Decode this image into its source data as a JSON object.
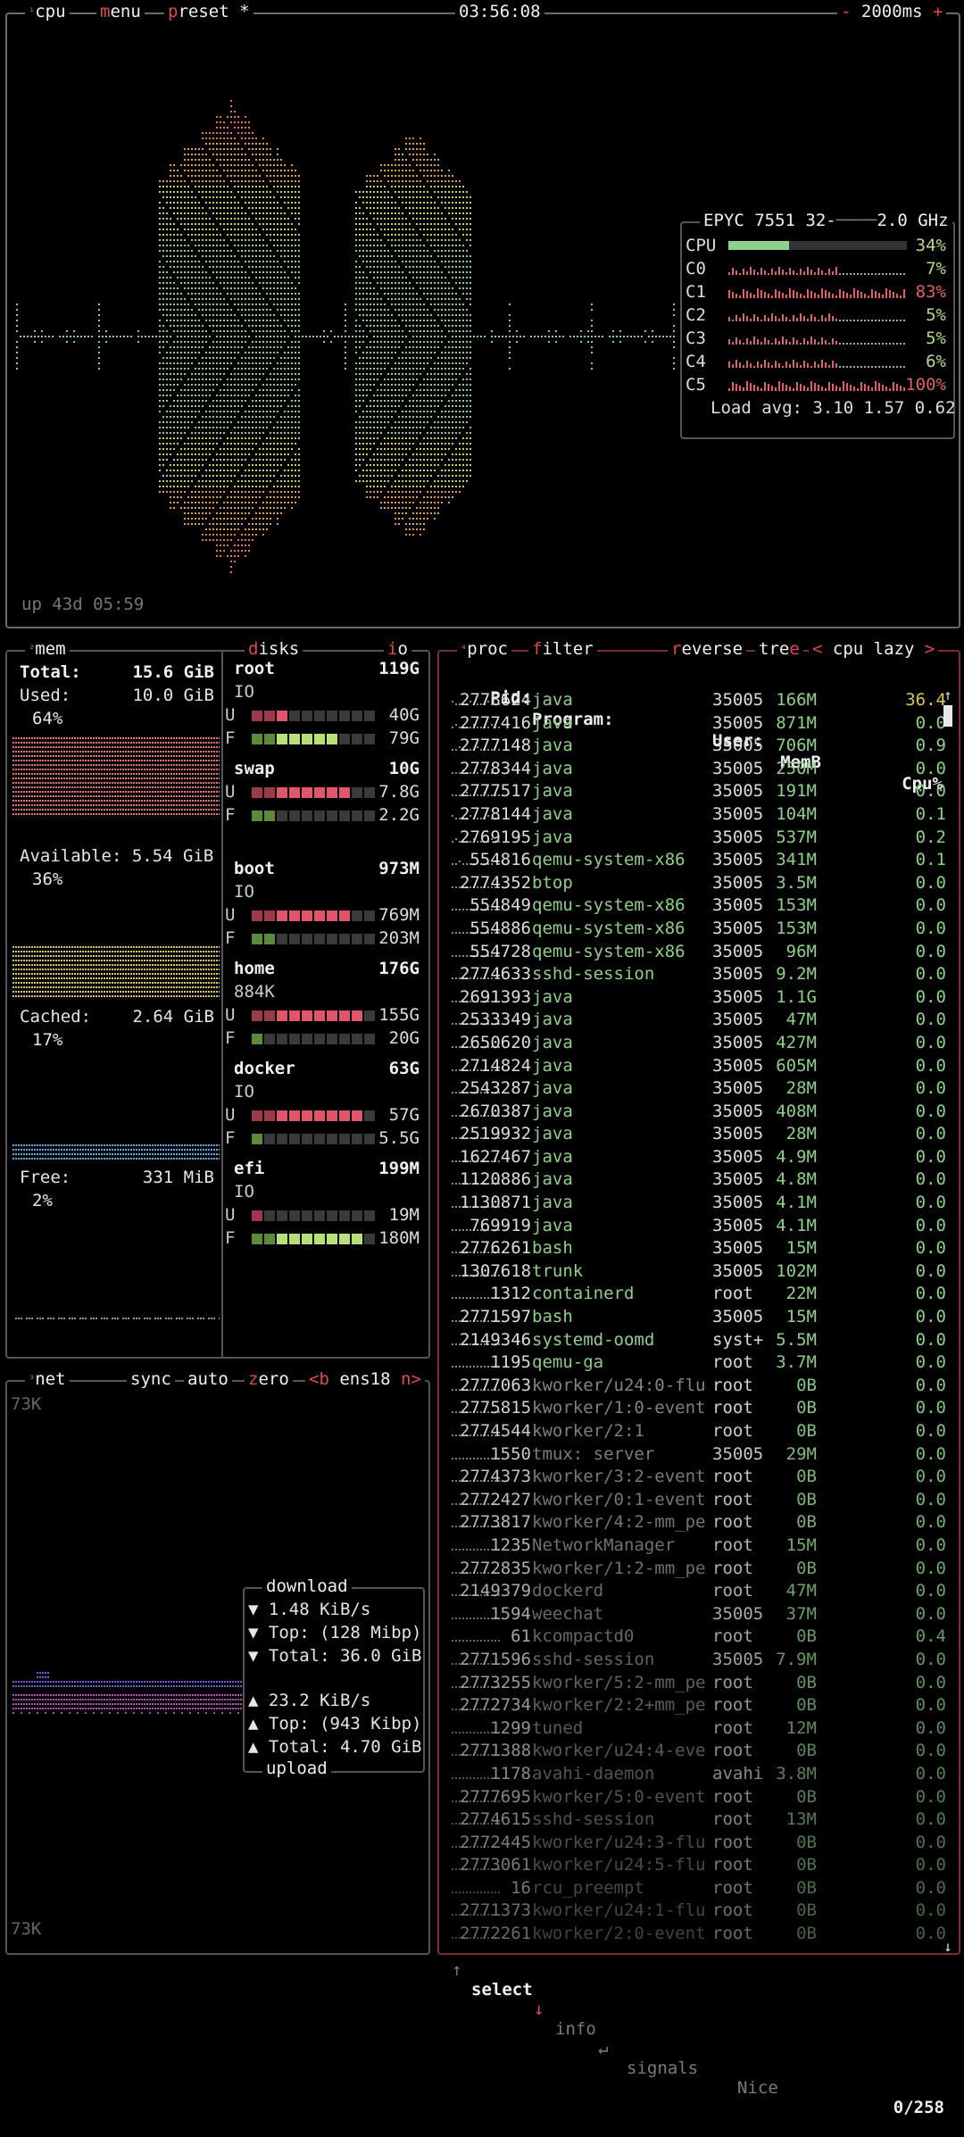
{
  "cpu": {
    "tab": "cpu",
    "tab_num": "¹",
    "menu": "menu",
    "preset": "preset *",
    "clock": "03:56:08",
    "minus": "-",
    "interval": "2000ms",
    "plus": "+",
    "uptime": "up 43d 05:59",
    "model": "EPYC 7551 32-",
    "freq": "2.0 GHz",
    "rows": [
      {
        "label": "CPU",
        "pct": "34%",
        "value": 34,
        "color": "#b7d982"
      },
      {
        "label": "C0",
        "pct": "7%",
        "value": 7,
        "color": "#b7d982"
      },
      {
        "label": "C1",
        "pct": "83%",
        "value": 83,
        "color": "#e06060"
      },
      {
        "label": "C2",
        "pct": "5%",
        "value": 5,
        "color": "#b7d982"
      },
      {
        "label": "C3",
        "pct": "5%",
        "value": 5,
        "color": "#b7d982"
      },
      {
        "label": "C4",
        "pct": "6%",
        "value": 6,
        "color": "#b7d982"
      },
      {
        "label": "C5",
        "pct": "100%",
        "value": 100,
        "color": "#e06060"
      }
    ],
    "load_label": "Load avg:",
    "load": "3.10 1.57 0.62"
  },
  "mem": {
    "tab_num": "²",
    "tab": "mem",
    "total_label": "Total:",
    "total": "15.6 GiB",
    "used_label": "Used:",
    "used": "10.0 GiB",
    "used_pct": "64%",
    "avail_label": "Available:",
    "avail": "5.54 GiB",
    "avail_pct": "36%",
    "cached_label": "Cached:",
    "cached": "2.64 GiB",
    "cached_pct": "17%",
    "free_label": "Free:",
    "free": "331 MiB",
    "free_pct": "2%",
    "colors": {
      "used": "#e07070",
      "avail": "#d9c65a",
      "cached": "#5aa9d9",
      "free": "#9c9c9c"
    }
  },
  "disks": {
    "tab": "disks",
    "io_tab": "io",
    "items": [
      {
        "name": "root",
        "size": "119G",
        "io": "IO",
        "u": "40G",
        "u_frac": 0.33,
        "f": "79G",
        "f_frac": 0.66
      },
      {
        "name": "swap",
        "size": "10G",
        "io": "",
        "u": "7.8G",
        "u_frac": 0.78,
        "f": "2.2G",
        "f_frac": 0.22
      },
      {
        "name": "boot",
        "size": "973M",
        "io": "IO",
        "u": "769M",
        "u_frac": 0.79,
        "f": "203M",
        "f_frac": 0.21
      },
      {
        "name": "home",
        "size": "176G",
        "io": "884K",
        "u": "155G",
        "u_frac": 0.88,
        "f": "20G",
        "f_frac": 0.12
      },
      {
        "name": "docker",
        "size": "63G",
        "io": "IO",
        "u": "57G",
        "u_frac": 0.9,
        "f": "5.5G",
        "f_frac": 0.1
      },
      {
        "name": "efi",
        "size": "199M",
        "io": "IO",
        "u": "19M",
        "u_frac": 0.1,
        "f": "180M",
        "f_frac": 0.9
      }
    ]
  },
  "net": {
    "tab_num": "³",
    "tab": "net",
    "sync": "sync",
    "auto": "auto",
    "zero": "zero",
    "prev": "<b",
    "iface": "ens18",
    "next": "n>",
    "scale_top": "73K",
    "scale_bottom": "73K",
    "download_title": "download",
    "dl_rate": "▼ 1.48 KiB/s",
    "dl_top": "▼ Top: (128 Mibp)",
    "dl_total": "▼ Total: 36.0 GiB",
    "ul_rate": "▲ 23.2 KiB/s",
    "ul_top": "▲ Top: (943 Kibp)",
    "ul_total": "▲ Total: 4.70 GiB",
    "upload_title": "upload"
  },
  "proc": {
    "tab_num": "⁴",
    "tab": "proc",
    "filter": "filter",
    "reverse": "reverse",
    "tree": "tree",
    "sort_prev": "<",
    "sort": "cpu lazy",
    "sort_next": ">",
    "headers": {
      "pid": "Pid:",
      "program": "Program:",
      "user": "User:",
      "mem": "MemB",
      "cpu": "Cpu%"
    },
    "rows": [
      {
        "pid": "2778624",
        "prog": "java",
        "user": "35005",
        "mem": "166M",
        "cpu": "36.4"
      },
      {
        "pid": "2777416",
        "prog": "java",
        "user": "35005",
        "mem": "871M",
        "cpu": "0.0"
      },
      {
        "pid": "2777148",
        "prog": "java",
        "user": "35005",
        "mem": "706M",
        "cpu": "0.9"
      },
      {
        "pid": "2778344",
        "prog": "java",
        "user": "35005",
        "mem": "250M",
        "cpu": "0.0"
      },
      {
        "pid": "2777517",
        "prog": "java",
        "user": "35005",
        "mem": "191M",
        "cpu": "0.0"
      },
      {
        "pid": "2778144",
        "prog": "java",
        "user": "35005",
        "mem": "104M",
        "cpu": "0.1"
      },
      {
        "pid": "2769195",
        "prog": "java",
        "user": "35005",
        "mem": "537M",
        "cpu": "0.2"
      },
      {
        "pid": "554816",
        "prog": "qemu-system-x86",
        "user": "35005",
        "mem": "341M",
        "cpu": "0.1"
      },
      {
        "pid": "2774352",
        "prog": "btop",
        "user": "35005",
        "mem": "3.5M",
        "cpu": "0.0"
      },
      {
        "pid": "554849",
        "prog": "qemu-system-x86",
        "user": "35005",
        "mem": "153M",
        "cpu": "0.0"
      },
      {
        "pid": "554886",
        "prog": "qemu-system-x86",
        "user": "35005",
        "mem": "153M",
        "cpu": "0.0"
      },
      {
        "pid": "554728",
        "prog": "qemu-system-x86",
        "user": "35005",
        "mem": "96M",
        "cpu": "0.0"
      },
      {
        "pid": "2774633",
        "prog": "sshd-session",
        "user": "35005",
        "mem": "9.2M",
        "cpu": "0.0"
      },
      {
        "pid": "2691393",
        "prog": "java",
        "user": "35005",
        "mem": "1.1G",
        "cpu": "0.0"
      },
      {
        "pid": "2533349",
        "prog": "java",
        "user": "35005",
        "mem": "47M",
        "cpu": "0.0"
      },
      {
        "pid": "2650620",
        "prog": "java",
        "user": "35005",
        "mem": "427M",
        "cpu": "0.0"
      },
      {
        "pid": "2714824",
        "prog": "java",
        "user": "35005",
        "mem": "605M",
        "cpu": "0.0"
      },
      {
        "pid": "2543287",
        "prog": "java",
        "user": "35005",
        "mem": "28M",
        "cpu": "0.0"
      },
      {
        "pid": "2670387",
        "prog": "java",
        "user": "35005",
        "mem": "408M",
        "cpu": "0.0"
      },
      {
        "pid": "2519932",
        "prog": "java",
        "user": "35005",
        "mem": "28M",
        "cpu": "0.0"
      },
      {
        "pid": "1627467",
        "prog": "java",
        "user": "35005",
        "mem": "4.9M",
        "cpu": "0.0"
      },
      {
        "pid": "1120886",
        "prog": "java",
        "user": "35005",
        "mem": "4.8M",
        "cpu": "0.0"
      },
      {
        "pid": "1130871",
        "prog": "java",
        "user": "35005",
        "mem": "4.1M",
        "cpu": "0.0"
      },
      {
        "pid": "769919",
        "prog": "java",
        "user": "35005",
        "mem": "4.1M",
        "cpu": "0.0"
      },
      {
        "pid": "2776261",
        "prog": "bash",
        "user": "35005",
        "mem": "15M",
        "cpu": "0.0"
      },
      {
        "pid": "1307618",
        "prog": "trunk",
        "user": "35005",
        "mem": "102M",
        "cpu": "0.0"
      },
      {
        "pid": "1312",
        "prog": "containerd",
        "user": "root",
        "mem": "22M",
        "cpu": "0.0"
      },
      {
        "pid": "2771597",
        "prog": "bash",
        "user": "35005",
        "mem": "15M",
        "cpu": "0.0"
      },
      {
        "pid": "2149346",
        "prog": "systemd-oomd",
        "user": "syst+",
        "mem": "5.5M",
        "cpu": "0.0"
      },
      {
        "pid": "1195",
        "prog": "qemu-ga",
        "user": "root",
        "mem": "3.7M",
        "cpu": "0.0"
      },
      {
        "pid": "2777063",
        "prog": "kworker/u24:0-flu",
        "user": "root",
        "mem": "0B",
        "cpu": "0.0"
      },
      {
        "pid": "2775815",
        "prog": "kworker/1:0-event",
        "user": "root",
        "mem": "0B",
        "cpu": "0.0"
      },
      {
        "pid": "2774544",
        "prog": "kworker/2:1",
        "user": "root",
        "mem": "0B",
        "cpu": "0.0"
      },
      {
        "pid": "1550",
        "prog": "tmux: server",
        "user": "35005",
        "mem": "29M",
        "cpu": "0.0"
      },
      {
        "pid": "2774373",
        "prog": "kworker/3:2-event",
        "user": "root",
        "mem": "0B",
        "cpu": "0.0"
      },
      {
        "pid": "2772427",
        "prog": "kworker/0:1-event",
        "user": "root",
        "mem": "0B",
        "cpu": "0.0"
      },
      {
        "pid": "2773817",
        "prog": "kworker/4:2-mm_pe",
        "user": "root",
        "mem": "0B",
        "cpu": "0.0"
      },
      {
        "pid": "1235",
        "prog": "NetworkManager",
        "user": "root",
        "mem": "15M",
        "cpu": "0.0"
      },
      {
        "pid": "2772835",
        "prog": "kworker/1:2-mm_pe",
        "user": "root",
        "mem": "0B",
        "cpu": "0.0"
      },
      {
        "pid": "2149379",
        "prog": "dockerd",
        "user": "root",
        "mem": "47M",
        "cpu": "0.0"
      },
      {
        "pid": "1594",
        "prog": "weechat",
        "user": "35005",
        "mem": "37M",
        "cpu": "0.0"
      },
      {
        "pid": "61",
        "prog": "kcompactd0",
        "user": "root",
        "mem": "0B",
        "cpu": "0.4"
      },
      {
        "pid": "2771596",
        "prog": "sshd-session",
        "user": "35005",
        "mem": "7.9M",
        "cpu": "0.0"
      },
      {
        "pid": "2773255",
        "prog": "kworker/5:2-mm_pe",
        "user": "root",
        "mem": "0B",
        "cpu": "0.0"
      },
      {
        "pid": "2772734",
        "prog": "kworker/2:2+mm_pe",
        "user": "root",
        "mem": "0B",
        "cpu": "0.0"
      },
      {
        "pid": "1299",
        "prog": "tuned",
        "user": "root",
        "mem": "12M",
        "cpu": "0.0"
      },
      {
        "pid": "2771388",
        "prog": "kworker/u24:4-eve",
        "user": "root",
        "mem": "0B",
        "cpu": "0.0"
      },
      {
        "pid": "1178",
        "prog": "avahi-daemon",
        "user": "avahi",
        "mem": "3.8M",
        "cpu": "0.0"
      },
      {
        "pid": "2777695",
        "prog": "kworker/5:0-event",
        "user": "root",
        "mem": "0B",
        "cpu": "0.0"
      },
      {
        "pid": "2774615",
        "prog": "sshd-session",
        "user": "root",
        "mem": "13M",
        "cpu": "0.0"
      },
      {
        "pid": "2772445",
        "prog": "kworker/u24:3-flu",
        "user": "root",
        "mem": "0B",
        "cpu": "0.0"
      },
      {
        "pid": "2773061",
        "prog": "kworker/u24:5-flu",
        "user": "root",
        "mem": "0B",
        "cpu": "0.0"
      },
      {
        "pid": "16",
        "prog": "rcu_preempt",
        "user": "root",
        "mem": "0B",
        "cpu": "0.0"
      },
      {
        "pid": "2771373",
        "prog": "kworker/u24:1-flu",
        "user": "root",
        "mem": "0B",
        "cpu": "0.0"
      },
      {
        "pid": "2772261",
        "prog": "kworker/2:0-event",
        "user": "root",
        "mem": "0B",
        "cpu": "0.0"
      }
    ],
    "footer": {
      "up": "↑",
      "select": "select",
      "down": "↓",
      "info": "info",
      "enter": "↵",
      "signals": "signals",
      "nice": "Nice",
      "count": "0/258"
    }
  }
}
